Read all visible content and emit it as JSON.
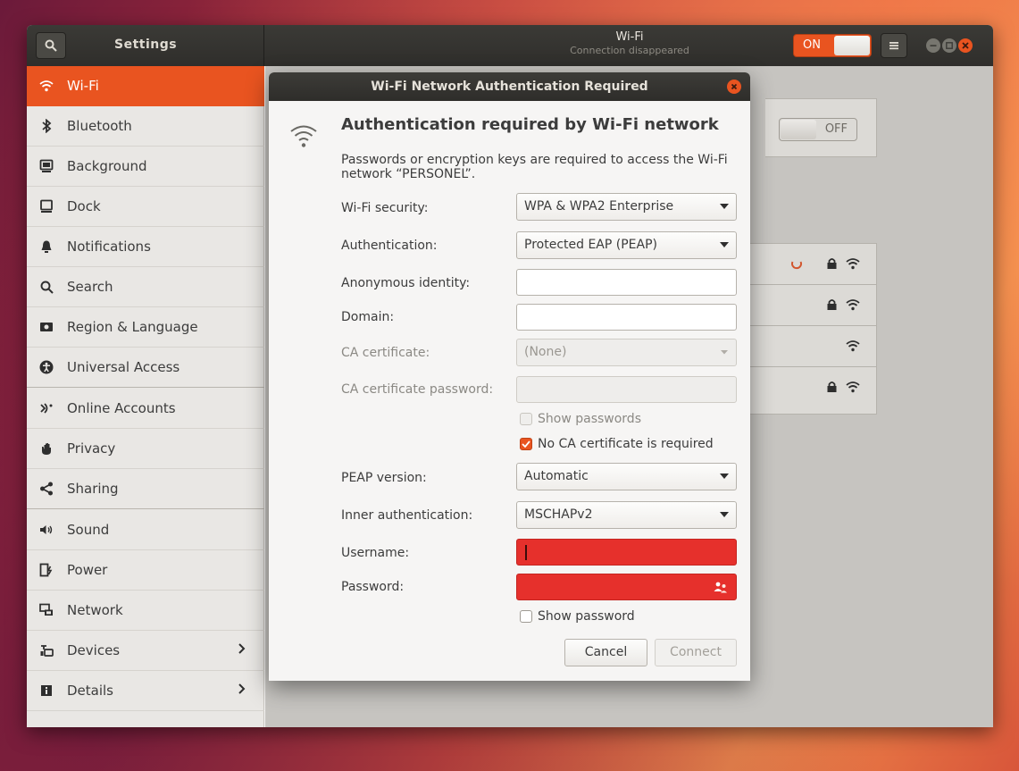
{
  "header": {
    "app_title": "Settings",
    "panel_title": "Wi-Fi",
    "panel_subtitle": "Connection disappeared",
    "wifi_switch_label": "ON"
  },
  "sidebar": {
    "items": [
      {
        "label": "Wi-Fi",
        "icon": "wifi-icon",
        "active": true
      },
      {
        "label": "Bluetooth",
        "icon": "bluetooth-icon"
      },
      {
        "label": "Background",
        "icon": "background-icon"
      },
      {
        "label": "Dock",
        "icon": "dock-icon"
      },
      {
        "label": "Notifications",
        "icon": "bell-icon"
      },
      {
        "label": "Search",
        "icon": "search-icon"
      },
      {
        "label": "Region & Language",
        "icon": "region-icon"
      },
      {
        "label": "Universal Access",
        "icon": "universal-access-icon"
      },
      {
        "label": "Online Accounts",
        "icon": "online-accounts-icon"
      },
      {
        "label": "Privacy",
        "icon": "hand-icon"
      },
      {
        "label": "Sharing",
        "icon": "share-icon"
      },
      {
        "label": "Sound",
        "icon": "speaker-icon"
      },
      {
        "label": "Power",
        "icon": "power-icon"
      },
      {
        "label": "Network",
        "icon": "network-icon"
      },
      {
        "label": "Devices",
        "icon": "devices-icon",
        "has_submenu": true
      },
      {
        "label": "Details",
        "icon": "info-icon",
        "has_submenu": true
      }
    ]
  },
  "main": {
    "airplane_toggle_label": "OFF"
  },
  "dialog": {
    "title": "Wi-Fi Network Authentication Required",
    "heading": "Authentication required by Wi-Fi network",
    "description": "Passwords or encryption keys are required to access the Wi-Fi network “PERSONEL”.",
    "wifi_security": {
      "label": "Wi-Fi security:",
      "value": "WPA & WPA2 Enterprise"
    },
    "authentication": {
      "label": "Authentication:",
      "value": "Protected EAP (PEAP)"
    },
    "anonymous_identity": {
      "label": "Anonymous identity:",
      "value": ""
    },
    "domain": {
      "label": "Domain:",
      "value": ""
    },
    "ca_certificate": {
      "label": "CA certificate:",
      "value": "(None)"
    },
    "ca_certificate_password": {
      "label": "CA certificate password:",
      "value": ""
    },
    "show_passwords": {
      "label": "Show passwords",
      "checked": false
    },
    "no_ca_required": {
      "label": "No CA certificate is required",
      "checked": true
    },
    "peap_version": {
      "label": "PEAP version:",
      "value": "Automatic"
    },
    "inner_authentication": {
      "label": "Inner authentication:",
      "value": "MSCHAPv2"
    },
    "username": {
      "label": "Username:",
      "value": ""
    },
    "password": {
      "label": "Password:",
      "value": ""
    },
    "show_password": {
      "label": "Show password",
      "checked": false
    },
    "cancel_label": "Cancel",
    "connect_label": "Connect"
  },
  "colors": {
    "accent": "#e95420",
    "error_field": "#e6302c",
    "headerbar": "#2f2e2b"
  }
}
